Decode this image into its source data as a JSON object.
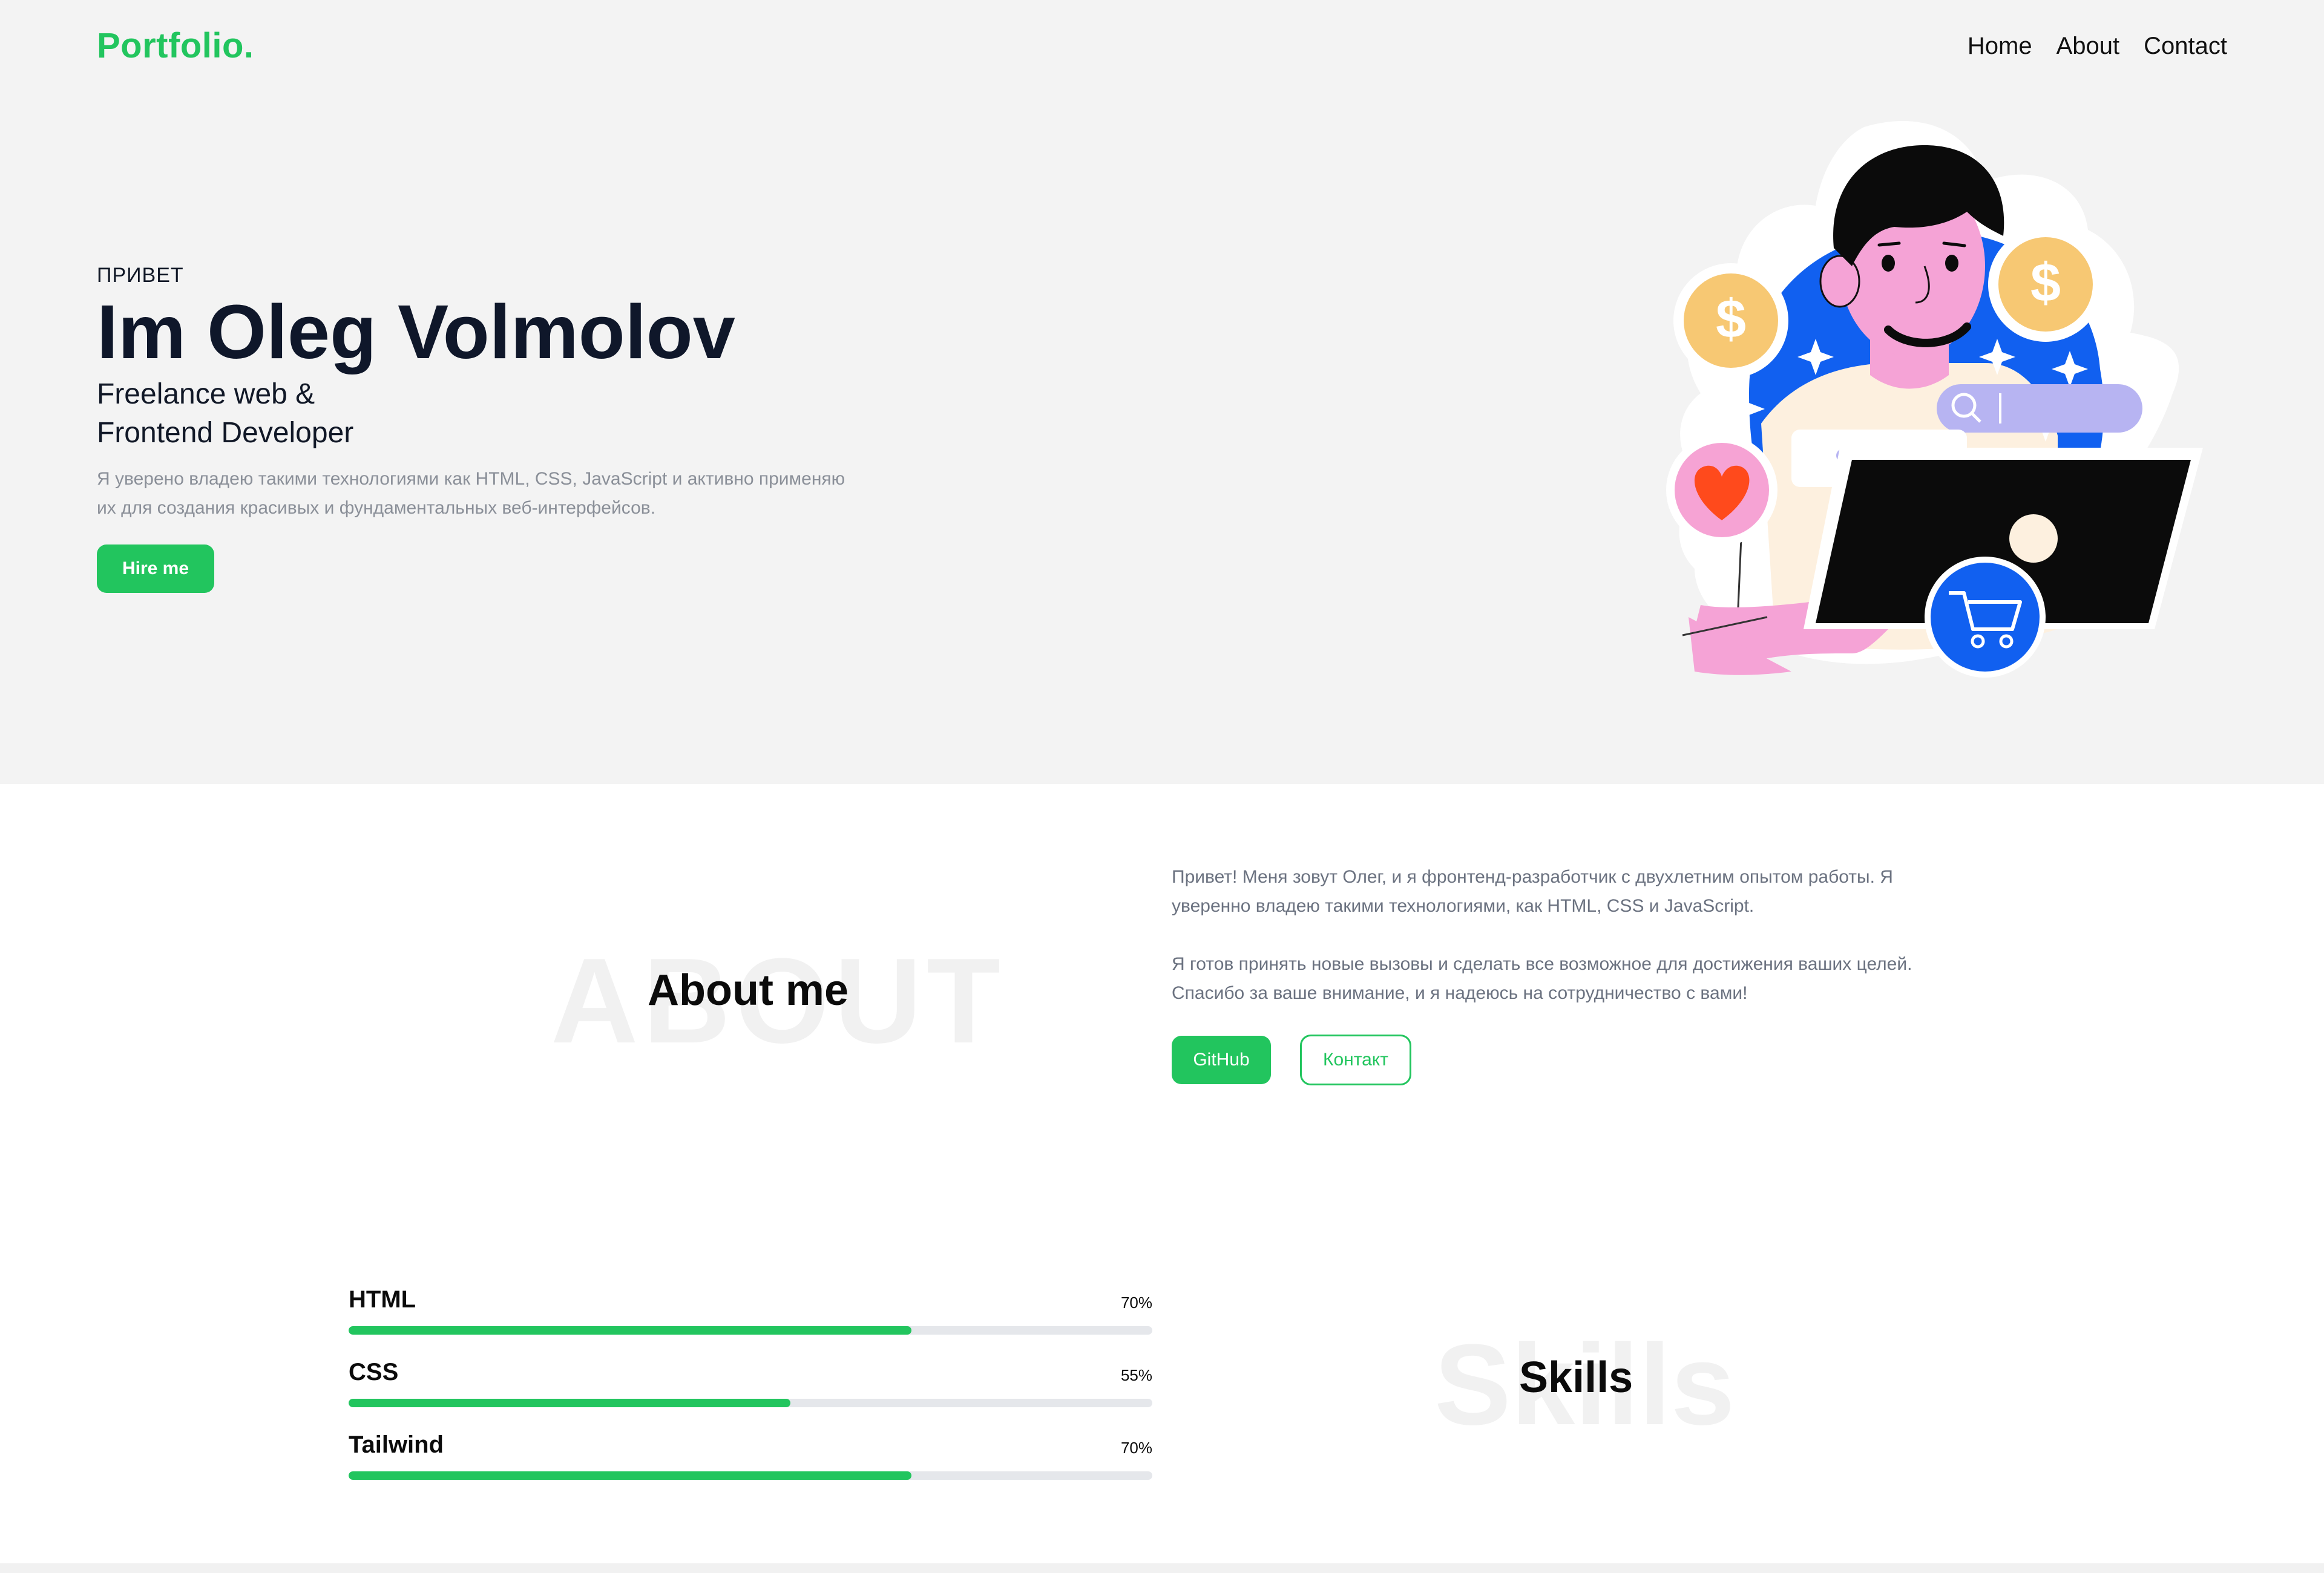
{
  "header": {
    "logo": "Portfolio.",
    "nav": [
      "Home",
      "About",
      "Contact"
    ]
  },
  "hero": {
    "greeting": "ПРИВЕТ",
    "title": "Im Oleg Volmolov",
    "subtitle_line1": "Freelance web &",
    "subtitle_line2": "Frontend Developer",
    "description": "Я уверено владею такими технологиями как HTML, CSS, JavaScript и активно применяю их для создания красивых и фундаментальных веб-интерфейсов.",
    "hire_button": "Hire me",
    "illustration_icon": "developer-illustration-icon"
  },
  "about": {
    "ghost_title": "ABOUT",
    "title": "About me",
    "paragraph1": "Привет! Меня зовут Олег, и я фронтенд-разработчик с двухлетним опытом работы. Я уверенно владею такими технологиями, как HTML, CSS и JavaScript.",
    "paragraph2": "Я готов принять новые вызовы и сделать все возможное для достижения ваших целей. Спасибо за ваше внимание, и я надеюсь на сотрудничество с вами!",
    "github_button": "GitHub",
    "contact_button": "Контакт"
  },
  "skills": {
    "ghost_title": "Skills",
    "title": "Skills",
    "items": [
      {
        "name": "HTML",
        "percent_label": "70%",
        "value": 70
      },
      {
        "name": "CSS",
        "percent_label": "55%",
        "value": 55
      },
      {
        "name": "Tailwind",
        "percent_label": "70%",
        "value": 70
      }
    ]
  },
  "colors": {
    "accent": "#22c55e",
    "hero_bg": "#f3f3f3",
    "illustration_blue": "#1160f0"
  }
}
